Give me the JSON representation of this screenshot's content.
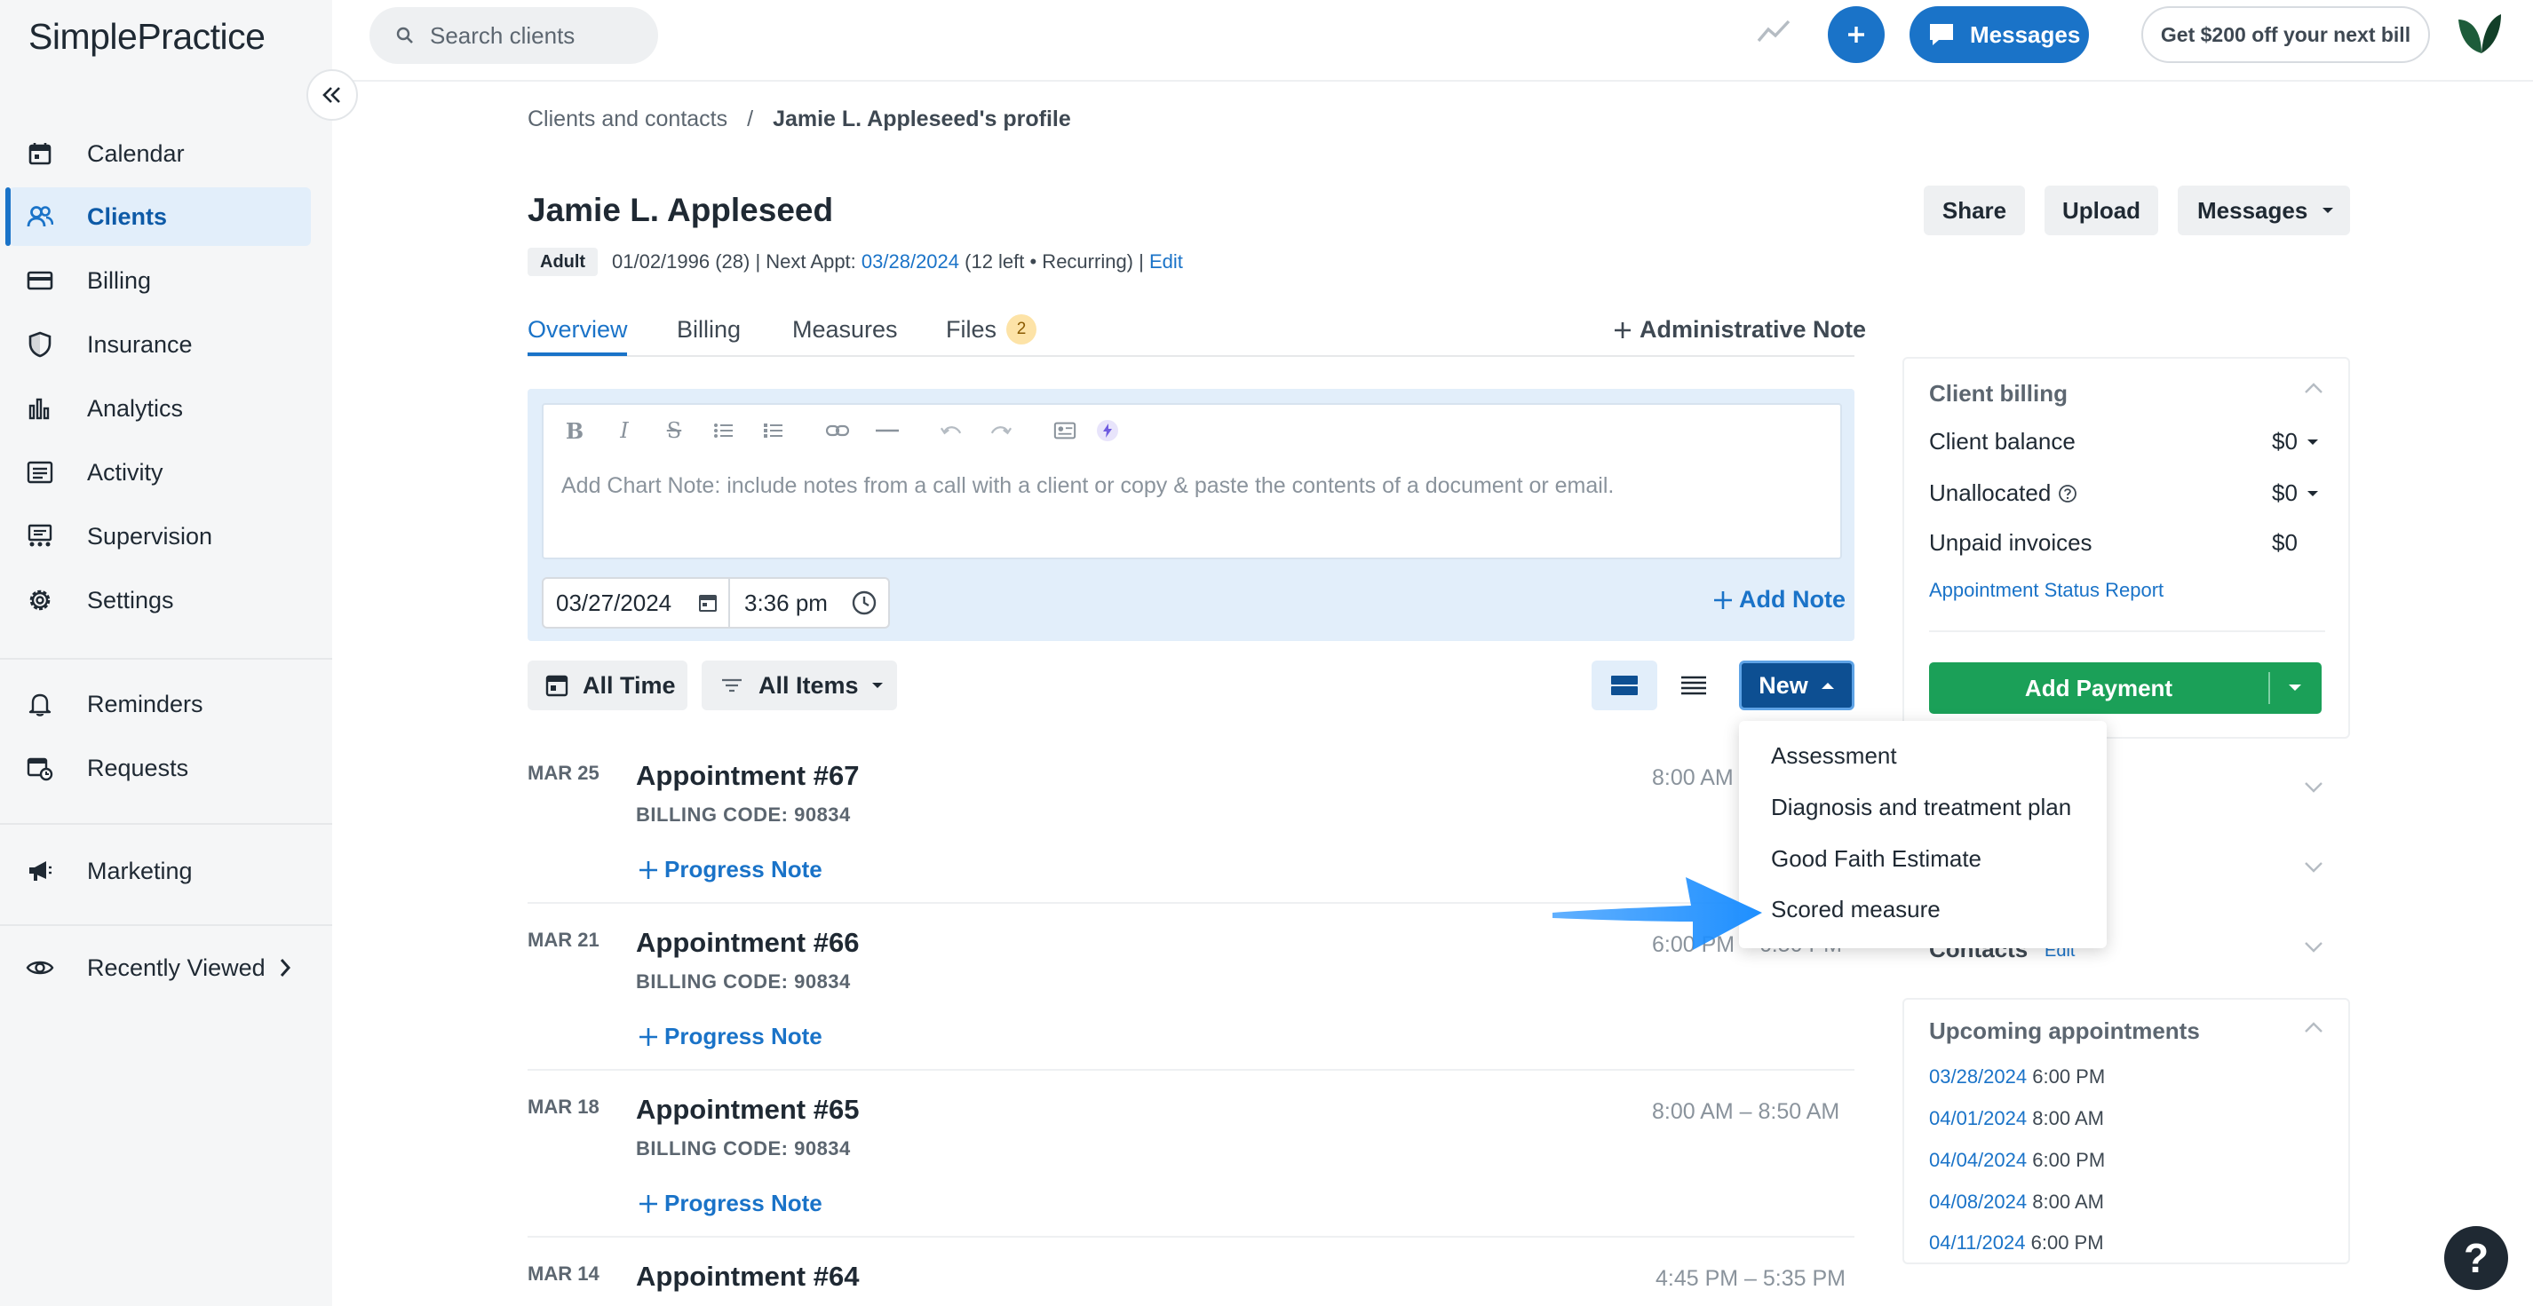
{
  "app": {
    "logo": "SimplePractice"
  },
  "search": {
    "placeholder": "Search clients"
  },
  "topbar": {
    "messages_label": "Messages",
    "promo_label": "Get $200 off your next bill"
  },
  "sidebar": {
    "items": [
      {
        "label": "Calendar",
        "icon": "calendar-icon"
      },
      {
        "label": "Clients",
        "icon": "users-icon",
        "active": true
      },
      {
        "label": "Billing",
        "icon": "credit-card-icon"
      },
      {
        "label": "Insurance",
        "icon": "shield-icon"
      },
      {
        "label": "Analytics",
        "icon": "bar-chart-icon"
      },
      {
        "label": "Activity",
        "icon": "activity-list-icon"
      },
      {
        "label": "Supervision",
        "icon": "supervision-icon"
      },
      {
        "label": "Settings",
        "icon": "gear-icon"
      },
      {
        "label": "Reminders",
        "icon": "bell-icon"
      },
      {
        "label": "Requests",
        "icon": "calendar-request-icon"
      },
      {
        "label": "Marketing",
        "icon": "megaphone-icon"
      },
      {
        "label": "Recently Viewed",
        "icon": "eye-icon"
      }
    ]
  },
  "breadcrumb": {
    "parent": "Clients and contacts",
    "separator": "/",
    "current": "Jamie L. Appleseed's profile"
  },
  "client": {
    "name": "Jamie L. Appleseed",
    "badge": "Adult",
    "dob": "01/02/1996 (28) | Next Appt: ",
    "next_appt": "03/28/2024",
    "appt_info": " (12 left • Recurring) | ",
    "edit": "Edit"
  },
  "header_buttons": {
    "share": "Share",
    "upload": "Upload",
    "messages": "Messages"
  },
  "tabs": [
    {
      "label": "Overview",
      "active": true
    },
    {
      "label": "Billing"
    },
    {
      "label": "Measures"
    },
    {
      "label": "Files",
      "count": "2"
    }
  ],
  "admin_note": "Administrative Note",
  "chart_note": {
    "placeholder": "Add Chart Note: include notes from a call with a client or copy & paste the contents of a document or email.",
    "date": "03/27/2024",
    "time": "3:36 pm",
    "add_note": "Add Note"
  },
  "filters": {
    "time": "All Time",
    "items": "All Items",
    "new": "New"
  },
  "new_menu": {
    "items": [
      "Assessment",
      "Diagnosis and treatment plan",
      "Good Faith Estimate",
      "Scored measure"
    ]
  },
  "appointments": [
    {
      "date": "MAR 25",
      "title": "Appointment #67",
      "code": "BILLING CODE: 90834",
      "note": "Progress Note",
      "time": "8:00 AM – 8:50 AM"
    },
    {
      "date": "MAR 21",
      "title": "Appointment #66",
      "code": "BILLING CODE: 90834",
      "note": "Progress Note",
      "time": "6:00 PM – 6:50 PM"
    },
    {
      "date": "MAR 18",
      "title": "Appointment #65",
      "code": "BILLING CODE: 90834",
      "note": "Progress Note",
      "time": "8:00 AM – 8:50 AM"
    },
    {
      "date": "MAR 14",
      "title": "Appointment #64",
      "code": "",
      "note": "",
      "time": "4:45 PM – 5:35 PM"
    }
  ],
  "client_billing": {
    "title": "Client billing",
    "rows": [
      {
        "label": "Client balance",
        "value": "$0"
      },
      {
        "label": "Unallocated",
        "value": "$0"
      },
      {
        "label": "Unpaid invoices",
        "value": "$0"
      }
    ],
    "report_link": "Appointment Status Report",
    "add_payment": "Add Payment"
  },
  "contacts": {
    "title": "Contacts",
    "edit": "Edit"
  },
  "upcoming": {
    "title": "Upcoming appointments",
    "items": [
      {
        "date": "03/28/2024",
        "time": "6:00 PM"
      },
      {
        "date": "04/01/2024",
        "time": "8:00 AM"
      },
      {
        "date": "04/04/2024",
        "time": "6:00 PM"
      },
      {
        "date": "04/08/2024",
        "time": "8:00 AM"
      },
      {
        "date": "04/11/2024",
        "time": "6:00 PM"
      }
    ]
  },
  "colors": {
    "accent": "#1a73c8",
    "new_button": "#0d4f92",
    "add_payment": "#1ba058",
    "arrow": "#1e8fff"
  }
}
